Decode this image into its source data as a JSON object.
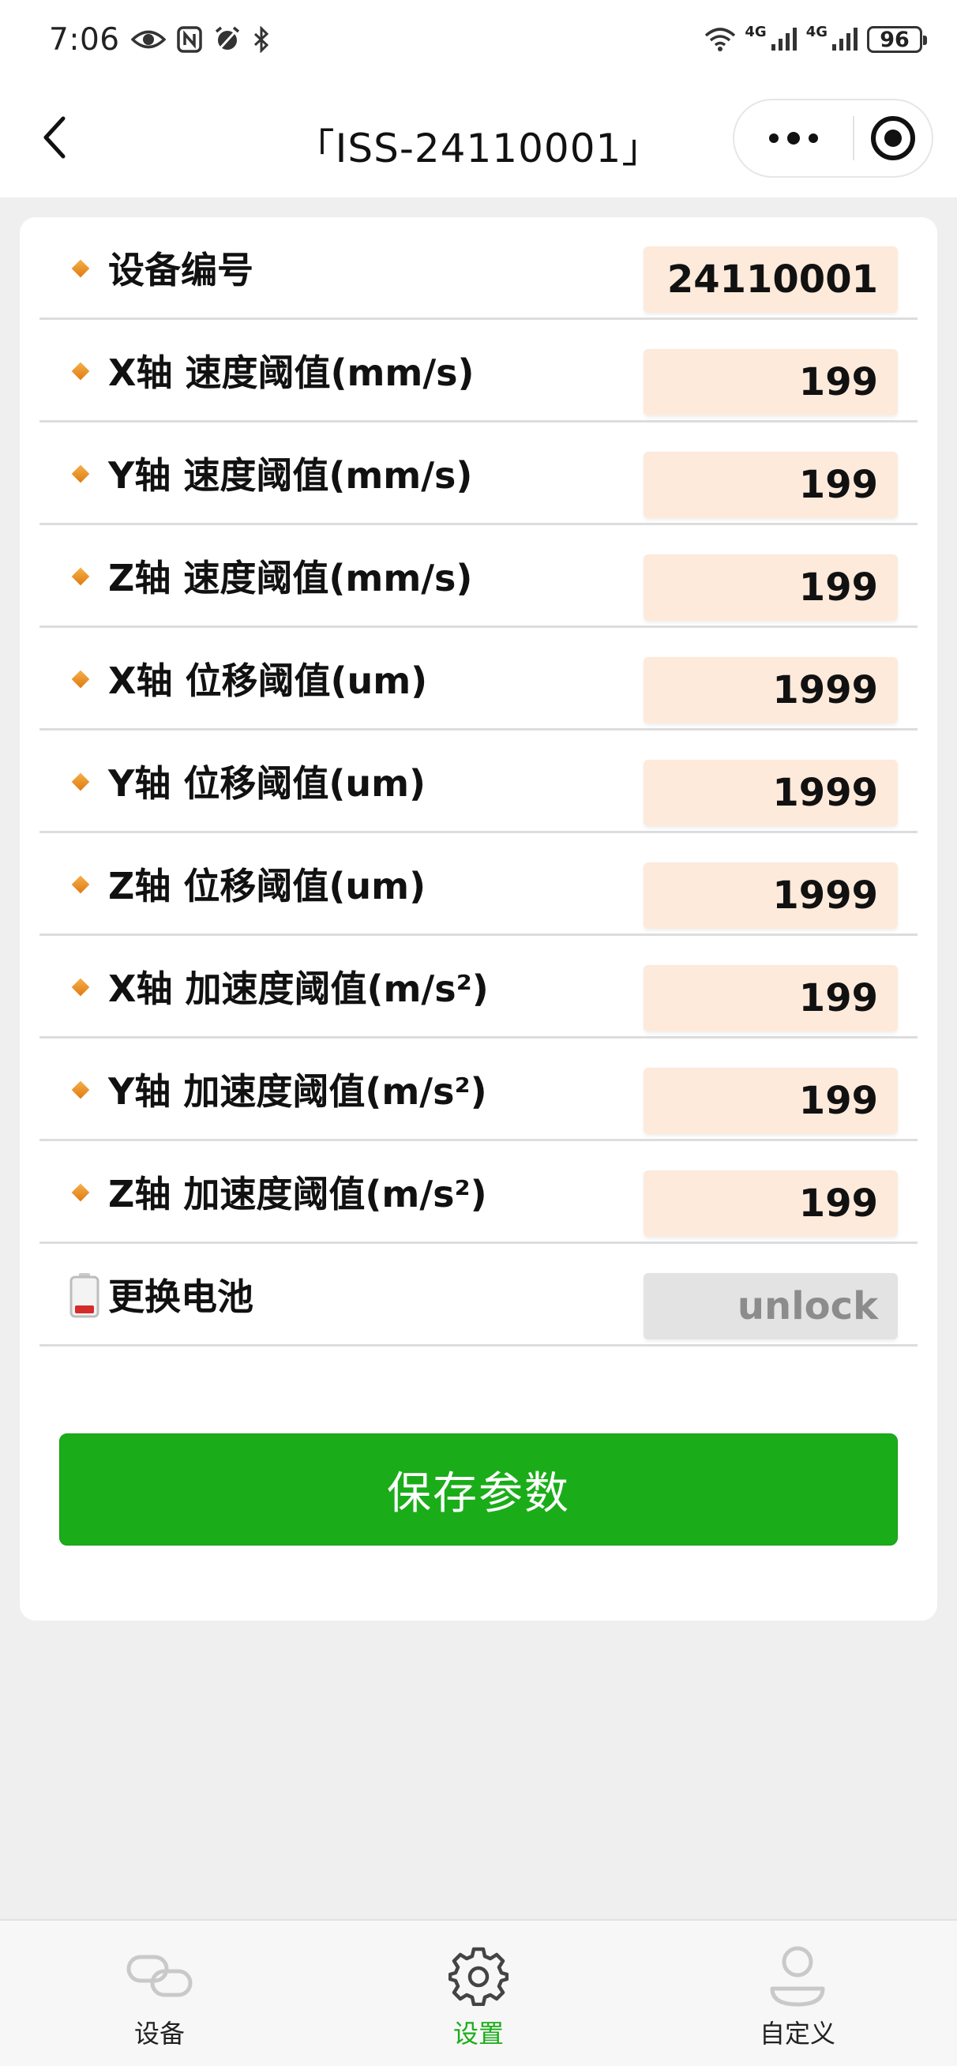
{
  "status_bar": {
    "time": "7:06",
    "network_1": "4G",
    "network_2": "4G",
    "battery": "96"
  },
  "nav": {
    "title": "「ISS-24110001」"
  },
  "params": [
    {
      "label": "设备编号",
      "value": "24110001"
    },
    {
      "label": "X轴 速度阈值(mm/s)",
      "value": "199"
    },
    {
      "label": "Y轴 速度阈值(mm/s)",
      "value": "199"
    },
    {
      "label": "Z轴 速度阈值(mm/s)",
      "value": "199"
    },
    {
      "label": "X轴 位移阈值(um)",
      "value": "1999"
    },
    {
      "label": "Y轴 位移阈值(um)",
      "value": "1999"
    },
    {
      "label": "Z轴 位移阈值(um)",
      "value": "1999"
    },
    {
      "label": "X轴 加速度阈值(m/s²)",
      "value": "199"
    },
    {
      "label": "Y轴 加速度阈值(m/s²)",
      "value": "199"
    },
    {
      "label": "Z轴 加速度阈值(m/s²)",
      "value": "199"
    }
  ],
  "battery_row": {
    "label": "更换电池",
    "value": "unlock"
  },
  "save_button": "保存参数",
  "tabs": [
    {
      "label": "设备",
      "icon": "link-icon",
      "active": false
    },
    {
      "label": "设置",
      "icon": "gear-icon",
      "active": true
    },
    {
      "label": "自定义",
      "icon": "user-icon",
      "active": false
    }
  ],
  "colors": {
    "accent": "#1aad19",
    "value_bg": "#fdeadb",
    "locked_bg": "#e3e3e3"
  }
}
